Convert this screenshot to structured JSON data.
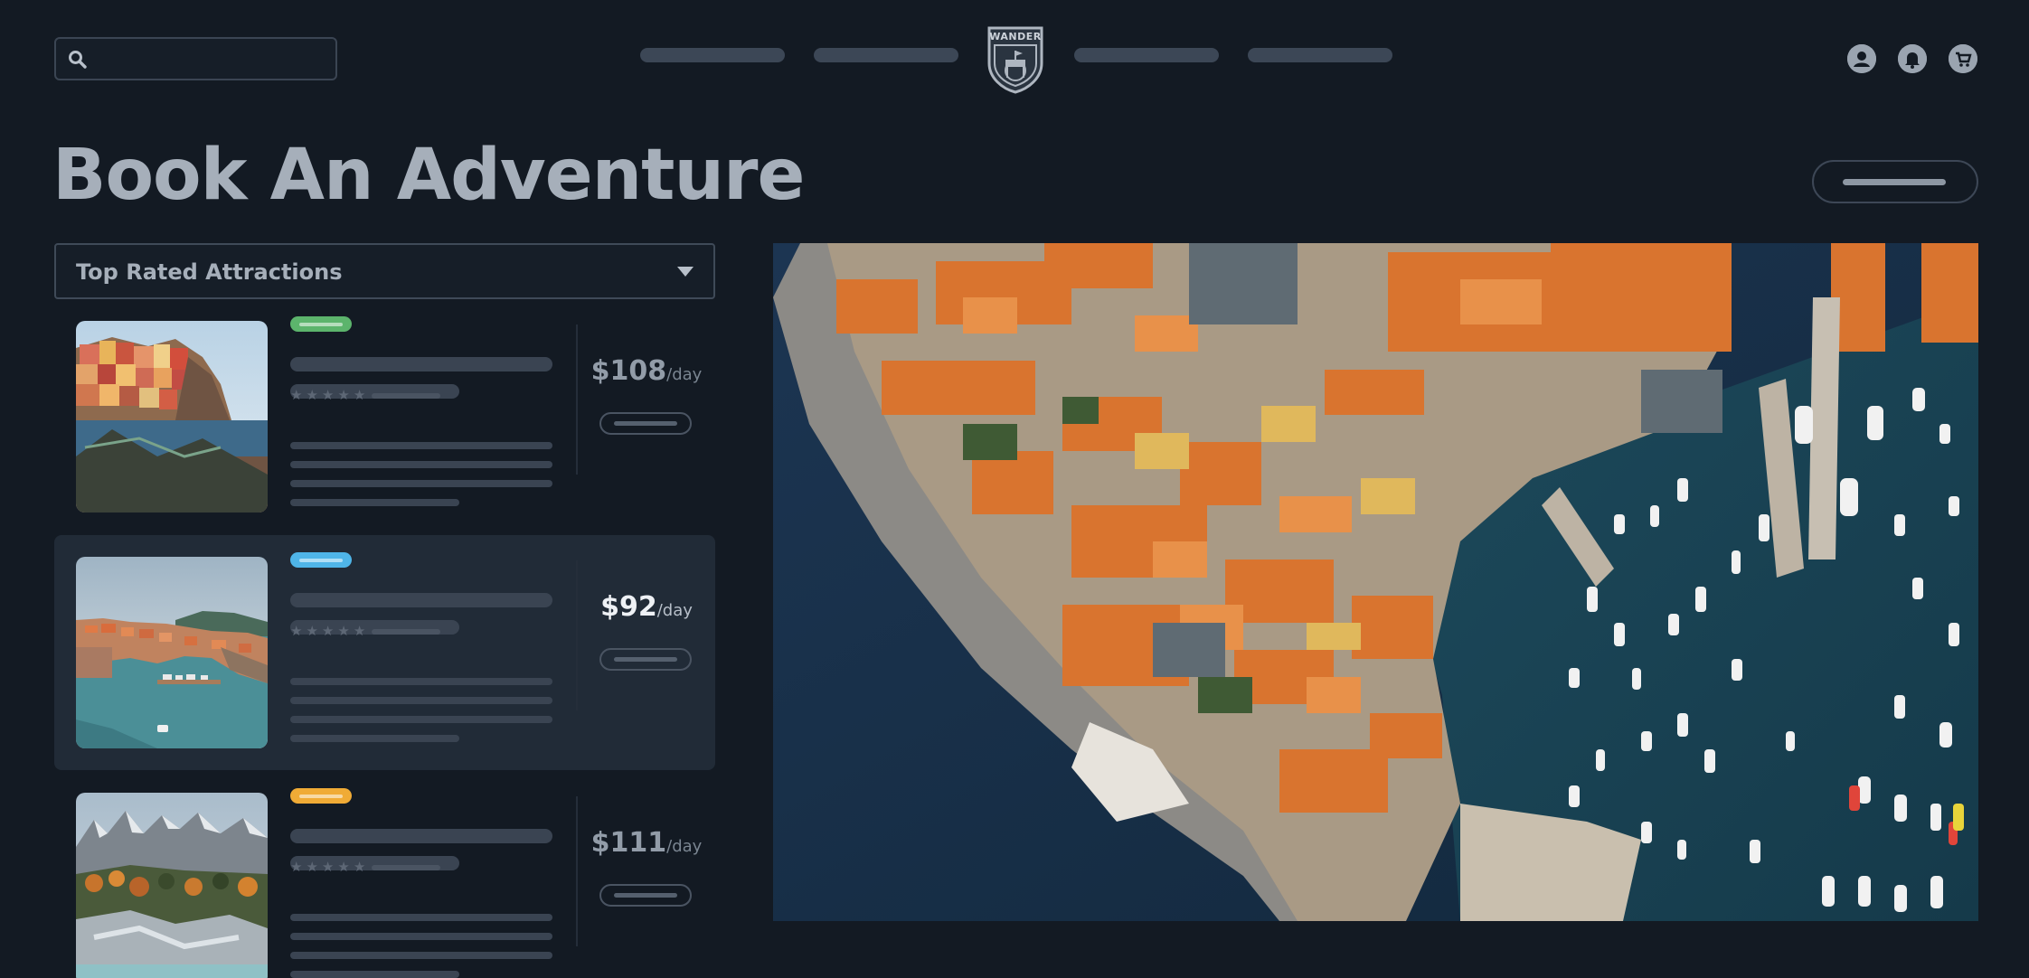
{
  "header": {
    "search": {
      "placeholder": "",
      "icon": "search-icon"
    },
    "nav_items": 4,
    "logo_text": "WANDER",
    "icons": [
      "account-icon",
      "notification-bell-icon",
      "cart-icon"
    ]
  },
  "page": {
    "title": "Book An Adventure"
  },
  "filter": {
    "selected": "Top Rated Attractions"
  },
  "colors": {
    "background": "#131a23",
    "selected_card": "#212b37",
    "tag_green": "#5cb46c",
    "tag_blue": "#4fb5e8",
    "tag_orange": "#f0ab36"
  },
  "listings": [
    {
      "price": "$108",
      "unit": "/day",
      "tag_color": "#5cb46c",
      "rating": 4.5,
      "selected": false
    },
    {
      "price": "$92",
      "unit": "/day",
      "tag_color": "#4fb5e8",
      "rating": 4.5,
      "selected": true
    },
    {
      "price": "$111",
      "unit": "/day",
      "tag_color": "#f0ab36",
      "rating": 4.5,
      "selected": false
    }
  ]
}
